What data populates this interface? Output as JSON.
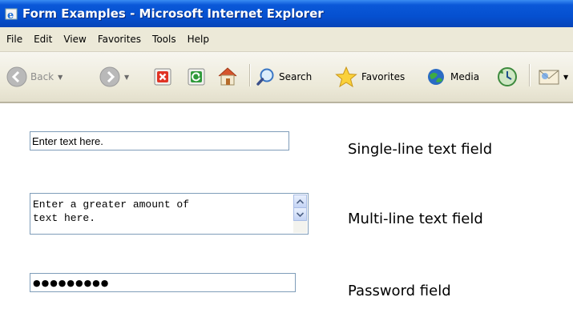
{
  "window": {
    "title": "Form Examples - Microsoft Internet Explorer"
  },
  "menubar": {
    "items": [
      "File",
      "Edit",
      "View",
      "Favorites",
      "Tools",
      "Help"
    ]
  },
  "toolbar": {
    "back_label": "Back",
    "search_label": "Search",
    "favorites_label": "Favorites",
    "media_label": "Media"
  },
  "form": {
    "single_line_value": "Enter text here.",
    "single_line_label": "Single-line text field",
    "multi_line_value": "Enter a greater amount of\ntext here.",
    "multi_line_label": "Multi-line text field",
    "password_value": "●●●●●●●●●",
    "password_label": "Password field"
  },
  "icons": {
    "back": "back-arrow-icon",
    "forward": "forward-arrow-icon",
    "stop": "stop-icon",
    "refresh": "refresh-icon",
    "home": "home-icon",
    "search": "search-icon",
    "favorites": "star-icon",
    "media": "media-icon",
    "history": "history-icon",
    "mail": "mail-icon"
  },
  "colors": {
    "titlebar": "#0a58d8",
    "chrome": "#ece9d8",
    "field_border": "#7f9db9"
  }
}
